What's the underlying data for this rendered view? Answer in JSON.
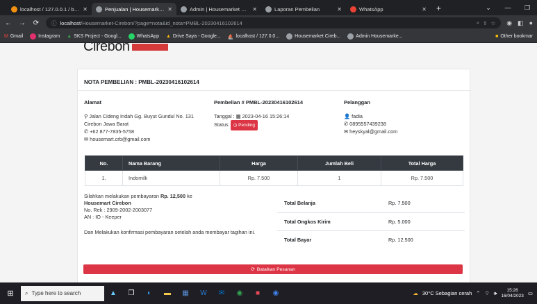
{
  "browser": {
    "tabs": [
      {
        "title": "localhost / 127.0.0.1 / bahan",
        "color": "#f29111"
      },
      {
        "title": "Penjualan | Housemarket Cire",
        "color": "#9aa0a6",
        "active": true
      },
      {
        "title": "Admin | Housemarket Cirebo",
        "color": "#9aa0a6"
      },
      {
        "title": "Laporan Pembelian",
        "color": "#9aa0a6"
      },
      {
        "title": "WhatsApp",
        "color": "#ea4335"
      }
    ],
    "url_host": "localhost",
    "url_path": "/Housemarket-Cirebon/?page=nota&id_nota=PMBL-20230416102614",
    "bookmarks": [
      "Gmail",
      "Instagram",
      "SKS Project - Googl...",
      "WhatsApp",
      "Drive Saya - Google...",
      "localhost / 127.0.0...",
      "Housemarket Cireb...",
      "Admin Housemarke..."
    ],
    "other_bookmarks": "Other bookmar"
  },
  "logo_text": "Cirebon",
  "invoice": {
    "title": "NOTA PEMBELIAN : PMBL-20230416102614",
    "address_label": "Alamat",
    "address_lines": [
      "Jalan Cideng Indah Gg. Buyut Gundul No. 131",
      "Cirebon Jawa Barat",
      "+62 877-7835-5758",
      "housemart.crb@gmail.com"
    ],
    "purchase_label": "Pembelian # PMBL-20230416102614",
    "date_label": "Tanggal :",
    "date_value": "2023-04-16 15:26:14",
    "status_label": "Status",
    "status_value": "Pending",
    "customer_label": "Pelanggan",
    "customer_name": "fadia",
    "customer_phone": "0895557439238",
    "customer_email": "heyskyal@gmail.com",
    "table_headers": [
      "No.",
      "Nama Barang",
      "Harga",
      "Jumlah Beli",
      "Total Harga"
    ],
    "rows": [
      [
        "1.",
        "Indomilk",
        "Rp. 7.500",
        "1",
        "Rp. 7.500"
      ]
    ],
    "pay_text_1": "Silahkan melakukan pembayaran",
    "pay_amount": "Rp. 12,500",
    "pay_text_2": "ke",
    "bank_name": "Housemart Cirebon",
    "account": "No. Rek : 2909-2002-2003077",
    "account_name": "AN : IO - Keeper",
    "confirm_text": "Dan Melakukan konfirmasi pembayaran setelah anda membayar tagihan ini.",
    "summary": [
      {
        "label": "Total Belanja",
        "value": "Rp. 7.500"
      },
      {
        "label": "Total Ongkos Kirim",
        "value": "Rp. 5.000"
      },
      {
        "label": "Total Bayar",
        "value": "Rp. 12.500"
      }
    ],
    "cancel_button": "Batalkan Pesanan"
  },
  "taskbar": {
    "search_placeholder": "Type here to search",
    "weather": "30°C  Sebagian cerah",
    "time": "15:26",
    "date": "16/04/2023"
  },
  "colors": {
    "danger": "#dc3545",
    "table_header": "#343a40"
  }
}
